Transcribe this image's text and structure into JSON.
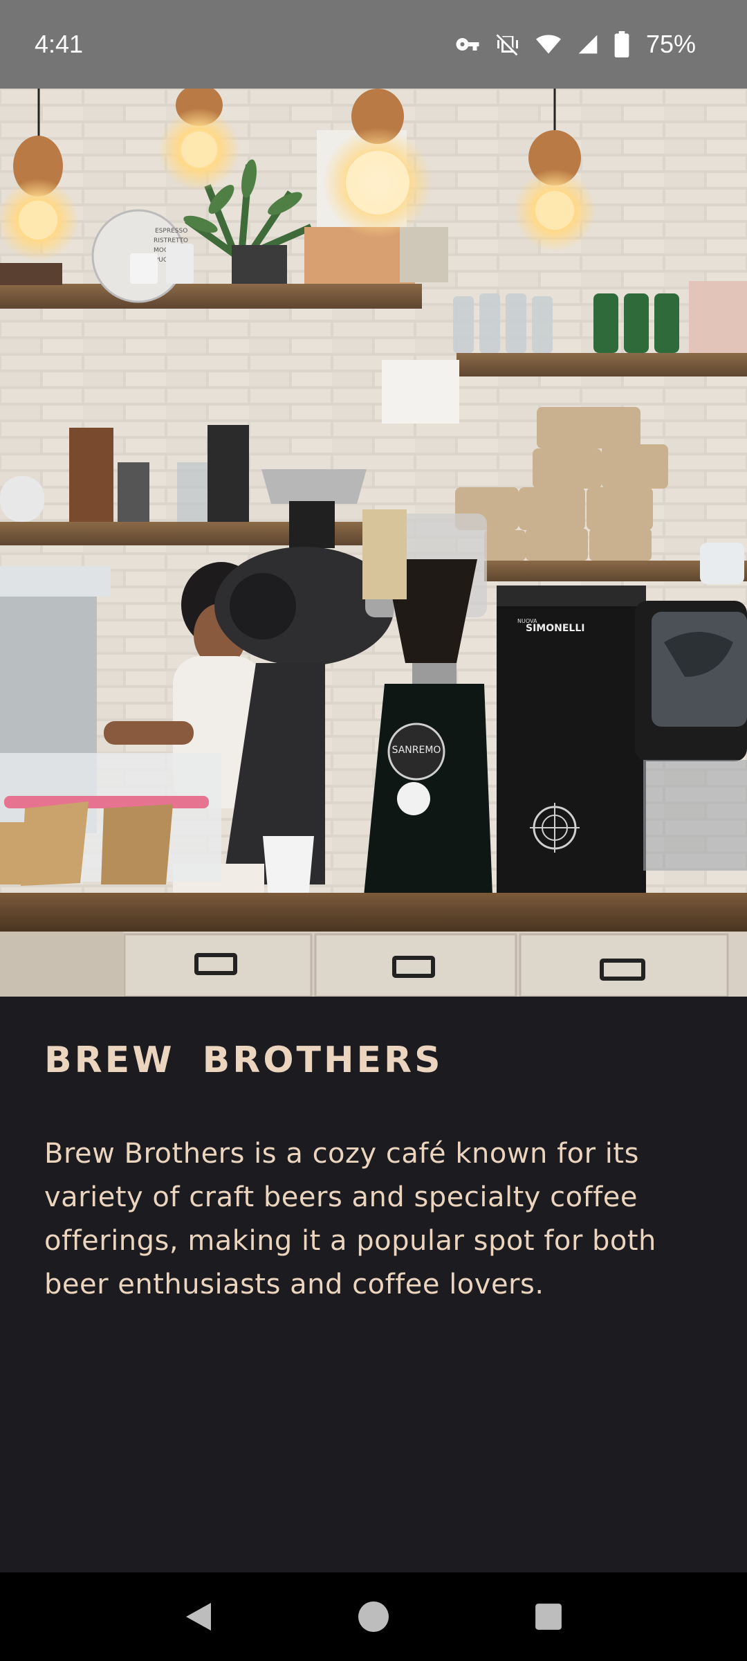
{
  "status_bar": {
    "time": "4:41",
    "battery": "75%",
    "icons": [
      "vpn-key-icon",
      "vibrate-off-icon",
      "wifi-icon",
      "signal-icon",
      "battery-icon"
    ]
  },
  "hero": {
    "image": "cafe-counter-photo",
    "sign_menu_text": [
      "ESPRESSO",
      "RISTRETTO",
      "MOCHA",
      "CAPPUCCINO"
    ],
    "grinder_brand": "SANREMO",
    "grinder2_brand": "SIMONELLI",
    "grinder2_subbrand": "NUOVA"
  },
  "content": {
    "title": "BREW  BROTHERS",
    "description": "Brew Brothers is a cozy café known for its variety of craft beers and specialty coffee offerings, making it a popular spot for both beer enthusiasts and coffee lovers."
  },
  "nav_bar": {
    "buttons": [
      "back-icon",
      "home-icon",
      "recents-icon"
    ]
  },
  "colors": {
    "status_bar_bg": "#757575",
    "content_bg": "#1c1b1f",
    "text_accent": "#ecd5bf",
    "nav_bg": "#000000"
  }
}
